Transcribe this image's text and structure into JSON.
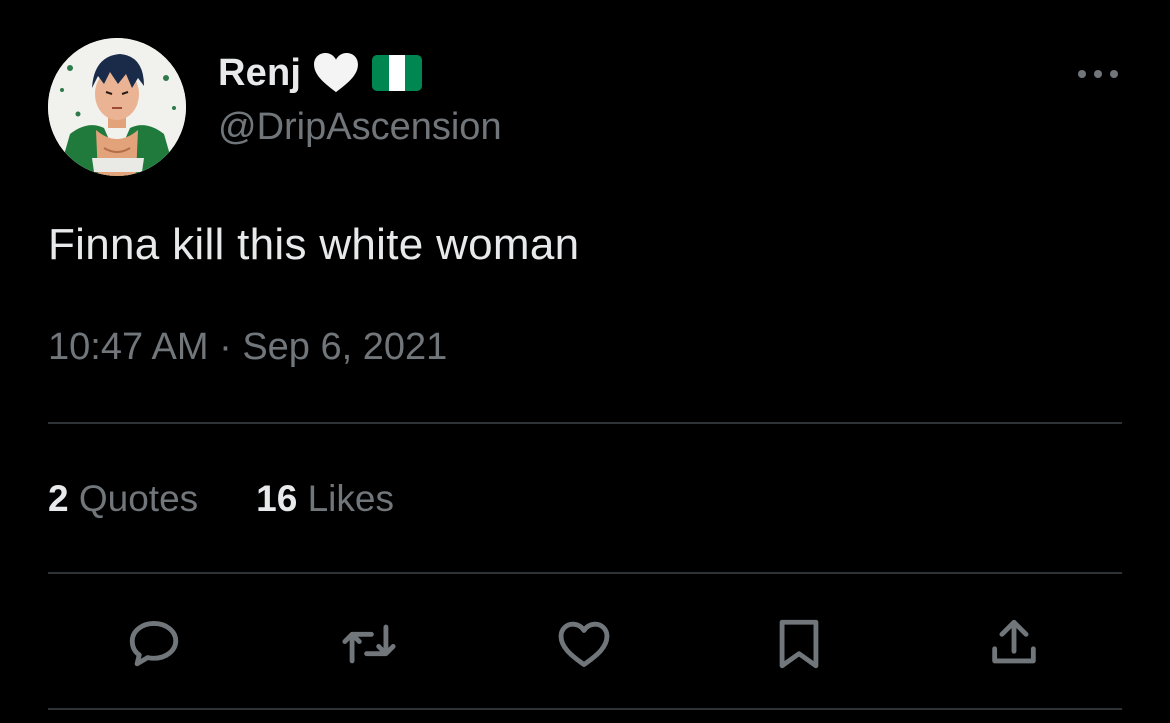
{
  "author": {
    "display_name": "Renj",
    "handle": "@DripAscension",
    "name_emojis": [
      "white-heart",
      "nigeria-flag"
    ]
  },
  "tweet": {
    "text": "Finna kill this white woman",
    "timestamp": "10:47 AM · Sep 6, 2021"
  },
  "stats": {
    "quotes_count": "2",
    "quotes_label": "Quotes",
    "likes_count": "16",
    "likes_label": "Likes"
  },
  "actions": [
    "reply",
    "retweet",
    "like",
    "bookmark",
    "share"
  ],
  "colors": {
    "background": "#000000",
    "primary_text": "#e7e9ea",
    "secondary_text": "#71767b",
    "divider": "#2f3336",
    "flag_green": "#008751"
  }
}
